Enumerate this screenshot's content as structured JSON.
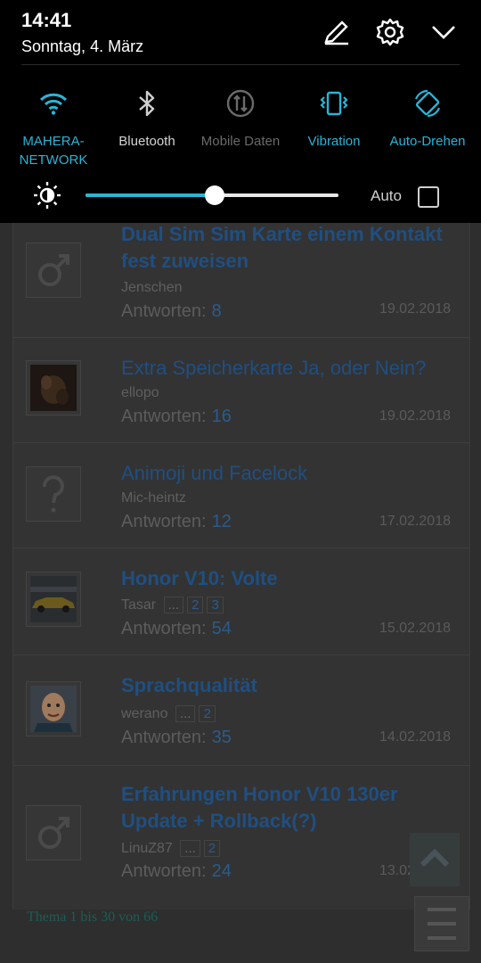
{
  "status": {
    "time": "14:41",
    "date": "Sonntag, 4. März"
  },
  "header_icons": [
    "edit-icon",
    "settings-icon",
    "collapse-chevron-icon"
  ],
  "tiles": [
    {
      "label": "MAHERA-\nNETWORK",
      "icon": "wifi-icon",
      "state": "on"
    },
    {
      "label": "Bluetooth",
      "icon": "bluetooth-icon",
      "state": "off"
    },
    {
      "label": "Mobile Daten",
      "icon": "mobile-data-icon",
      "state": "disabled"
    },
    {
      "label": "Vibration",
      "icon": "vibration-icon",
      "state": "on"
    },
    {
      "label": "Auto-Drehen",
      "icon": "auto-rotate-icon",
      "state": "on"
    }
  ],
  "brightness": {
    "level_percent": 51,
    "auto_label": "Auto",
    "auto_checked": false
  },
  "accent_color": "#2bb4d6",
  "threads": [
    {
      "title": "Dual Sim Sim Karte einem Kontakt fest zuweisen",
      "bold": true,
      "author": "Jenschen",
      "pages": [],
      "replies_label": "Antworten:",
      "replies": "8",
      "date": "19.02.2018",
      "avatar": "male-placeholder-icon"
    },
    {
      "title": "Extra Speicherkarte Ja, oder Nein?",
      "bold": false,
      "author": "ellopo",
      "pages": [],
      "replies_label": "Antworten:",
      "replies": "16",
      "date": "19.02.2018",
      "avatar": "user-photo-avatar"
    },
    {
      "title": "Animoji und Facelock",
      "bold": false,
      "author": "Mic-heintz",
      "pages": [],
      "replies_label": "Antworten:",
      "replies": "12",
      "date": "17.02.2018",
      "avatar": "unknown-placeholder-icon"
    },
    {
      "title": "Honor V10: Volte",
      "bold": true,
      "author": "Tasar",
      "pages": [
        "...",
        "2",
        "3"
      ],
      "replies_label": "Antworten:",
      "replies": "54",
      "date": "15.02.2018",
      "avatar": "car-photo-avatar"
    },
    {
      "title": "Sprachqualität",
      "bold": true,
      "author": "werano",
      "pages": [
        "...",
        "2"
      ],
      "replies_label": "Antworten:",
      "replies": "35",
      "date": "14.02.2018",
      "avatar": "cartoon-face-avatar"
    },
    {
      "title": "Erfahrungen Honor V10 130er Update + Rollback(?)",
      "bold": true,
      "author": "LinuZ87",
      "pages": [
        "...",
        "2"
      ],
      "replies_label": "Antworten:",
      "replies": "24",
      "date": "13.02.2018",
      "avatar": "male-placeholder-icon"
    }
  ],
  "footer": {
    "summary": "Thema 1 bis 30 von 66"
  }
}
